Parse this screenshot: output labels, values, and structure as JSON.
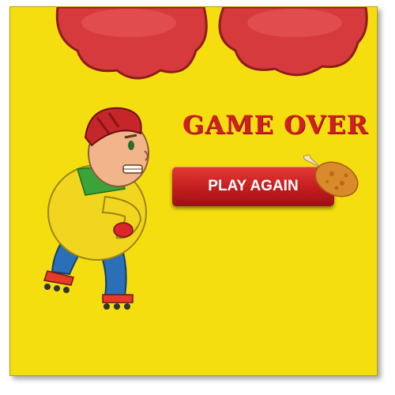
{
  "game": {
    "title": "GAME OVER",
    "play_again_label": "PLAY AGAIN"
  },
  "colors": {
    "background": "#f5de10",
    "accent_red": "#d01f24",
    "button_red": "#c41d1f"
  }
}
